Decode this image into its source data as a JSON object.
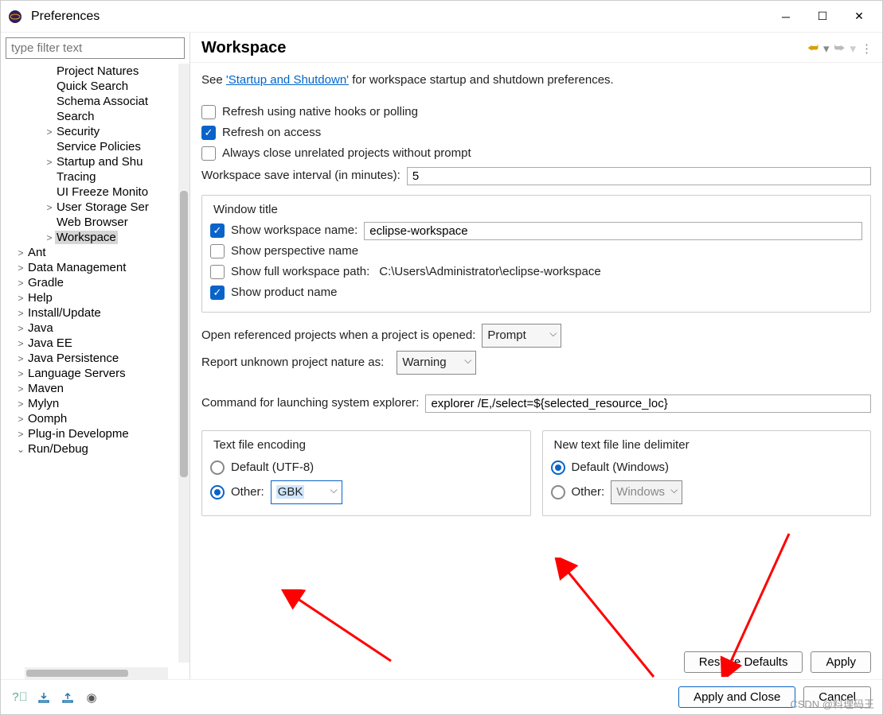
{
  "window": {
    "title": "Preferences"
  },
  "filter": {
    "placeholder": "type filter text"
  },
  "tree": {
    "items": [
      {
        "indent": 3,
        "expand": "",
        "label": "Project Natures"
      },
      {
        "indent": 3,
        "expand": "",
        "label": "Quick Search"
      },
      {
        "indent": 3,
        "expand": "",
        "label": "Schema Associat"
      },
      {
        "indent": 3,
        "expand": "",
        "label": "Search"
      },
      {
        "indent": 3,
        "expand": ">",
        "label": "Security"
      },
      {
        "indent": 3,
        "expand": "",
        "label": "Service Policies"
      },
      {
        "indent": 3,
        "expand": ">",
        "label": "Startup and Shu"
      },
      {
        "indent": 3,
        "expand": "",
        "label": "Tracing"
      },
      {
        "indent": 3,
        "expand": "",
        "label": "UI Freeze Monito"
      },
      {
        "indent": 3,
        "expand": ">",
        "label": "User Storage Ser"
      },
      {
        "indent": 3,
        "expand": "",
        "label": "Web Browser"
      },
      {
        "indent": 3,
        "expand": ">",
        "label": "Workspace",
        "selected": true
      },
      {
        "indent": 1,
        "expand": ">",
        "label": "Ant"
      },
      {
        "indent": 1,
        "expand": ">",
        "label": "Data Management"
      },
      {
        "indent": 1,
        "expand": ">",
        "label": "Gradle"
      },
      {
        "indent": 1,
        "expand": ">",
        "label": "Help"
      },
      {
        "indent": 1,
        "expand": ">",
        "label": "Install/Update"
      },
      {
        "indent": 1,
        "expand": ">",
        "label": "Java"
      },
      {
        "indent": 1,
        "expand": ">",
        "label": "Java EE"
      },
      {
        "indent": 1,
        "expand": ">",
        "label": "Java Persistence"
      },
      {
        "indent": 1,
        "expand": ">",
        "label": "Language Servers"
      },
      {
        "indent": 1,
        "expand": ">",
        "label": "Maven"
      },
      {
        "indent": 1,
        "expand": ">",
        "label": "Mylyn"
      },
      {
        "indent": 1,
        "expand": ">",
        "label": "Oomph"
      },
      {
        "indent": 1,
        "expand": ">",
        "label": "Plug-in Developme"
      },
      {
        "indent": 1,
        "expand": "v",
        "label": "Run/Debug"
      }
    ]
  },
  "page": {
    "title": "Workspace",
    "see_prefix": "See ",
    "see_link": "'Startup and Shutdown'",
    "see_suffix": " for workspace startup and shutdown preferences.",
    "refresh_native": "Refresh using native hooks or polling",
    "refresh_access": "Refresh on access",
    "close_unrelated": "Always close unrelated projects without prompt",
    "save_interval_label": "Workspace save interval (in minutes):",
    "save_interval_value": "5",
    "window_title_group": "Window title",
    "show_ws_name": "Show workspace name:",
    "ws_name_value": "eclipse-workspace",
    "show_persp": "Show perspective name",
    "show_full_path_label": "Show full workspace path:",
    "show_full_path_value": "C:\\Users\\Administrator\\eclipse-workspace",
    "show_product": "Show product name",
    "open_ref_label": "Open referenced projects when a project is opened:",
    "open_ref_value": "Prompt",
    "report_nature_label": "Report unknown project nature as:",
    "report_nature_value": "Warning",
    "explorer_label": "Command for launching system explorer:",
    "explorer_value": "explorer /E,/select=${selected_resource_loc}",
    "encoding_group": "Text file encoding",
    "encoding_default": "Default (UTF-8)",
    "encoding_other": "Other:",
    "encoding_other_value": "GBK",
    "delimiter_group": "New text file line delimiter",
    "delimiter_default": "Default (Windows)",
    "delimiter_other": "Other:",
    "delimiter_other_value": "Windows",
    "restore_defaults": "Restore Defaults",
    "apply": "Apply",
    "apply_close": "Apply and Close",
    "cancel": "Cancel"
  },
  "watermark": "CSDN @料理码王"
}
